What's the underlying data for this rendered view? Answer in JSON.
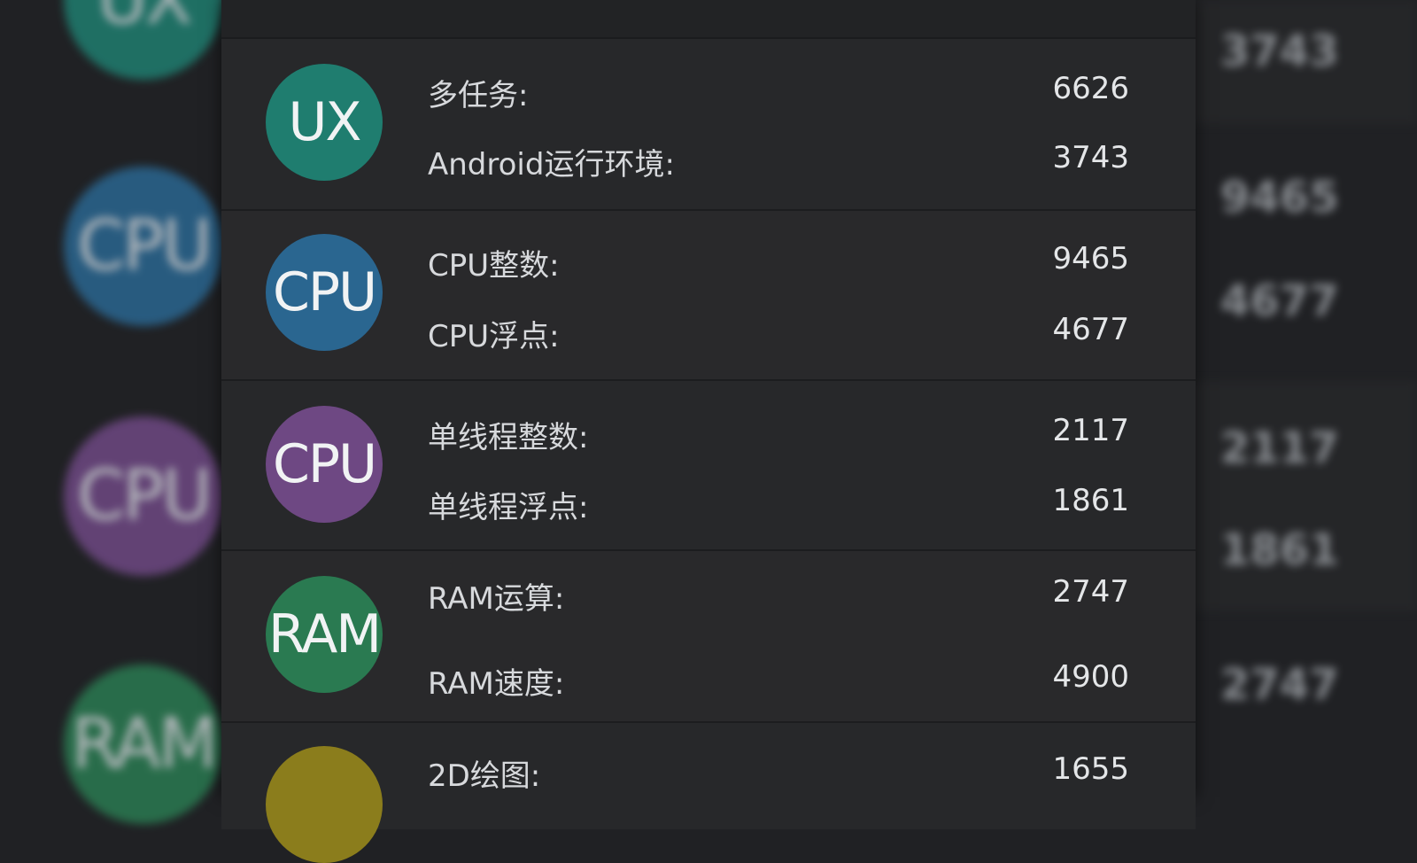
{
  "header": {
    "title": ""
  },
  "colors": {
    "ux": "#1f7d6f",
    "cpu_blue": "#2a6690",
    "cpu_purple": "#6e4883",
    "ram": "#2a7a51",
    "gpu": "#8b7d1c"
  },
  "groups": [
    {
      "icon": "UX",
      "icon_name": "ux-badge-icon",
      "items": [
        {
          "label": "多任务:",
          "value": "6626"
        },
        {
          "label": "Android运行环境:",
          "value": "3743"
        }
      ]
    },
    {
      "icon": "CPU",
      "icon_name": "cpu-badge-icon",
      "items": [
        {
          "label": "CPU整数:",
          "value": "9465"
        },
        {
          "label": "CPU浮点:",
          "value": "4677"
        }
      ]
    },
    {
      "icon": "CPU",
      "icon_name": "cpu-single-thread-badge-icon",
      "items": [
        {
          "label": "单线程整数:",
          "value": "2117"
        },
        {
          "label": "单线程浮点:",
          "value": "1861"
        }
      ]
    },
    {
      "icon": "RAM",
      "icon_name": "ram-badge-icon",
      "items": [
        {
          "label": "RAM运算:",
          "value": "2747"
        },
        {
          "label": "RAM速度:",
          "value": "4900"
        }
      ]
    },
    {
      "icon": "",
      "icon_name": "gpu-badge-icon",
      "items": [
        {
          "label": "2D绘图:",
          "value": "1655"
        }
      ]
    }
  ],
  "background": {
    "left_icons": [
      "UX",
      "CPU",
      "CPU",
      "RAM"
    ],
    "right_values": [
      "3743",
      "9465",
      "4677",
      "2117",
      "1861",
      "2747"
    ]
  }
}
